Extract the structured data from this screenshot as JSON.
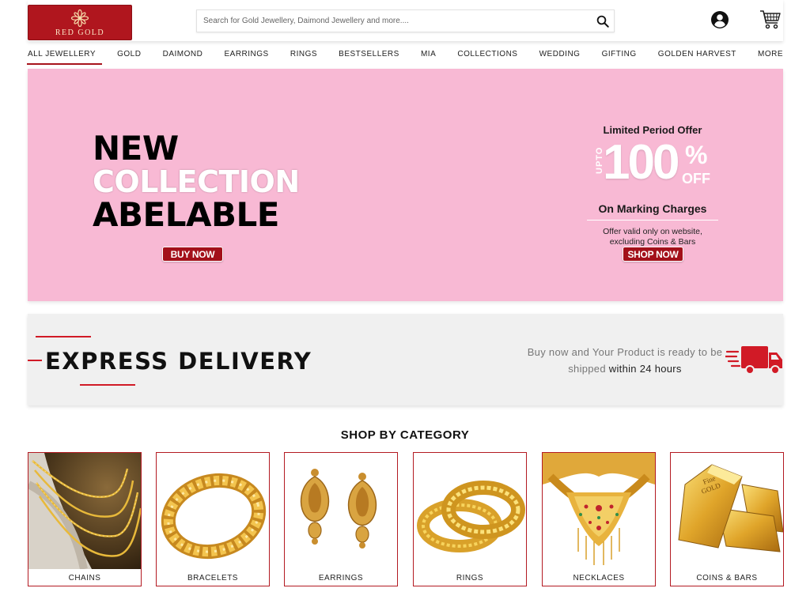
{
  "header": {
    "logo_text": "RED GOLD",
    "search_placeholder": "Search for Gold Jewellery, Daimond Jewellery and more....",
    "icons": [
      "search-icon",
      "user-icon",
      "cart-icon"
    ]
  },
  "nav": {
    "items": [
      {
        "label": "ALL JEWELLERY",
        "active": true
      },
      {
        "label": "GOLD"
      },
      {
        "label": "DAIMOND"
      },
      {
        "label": "EARRINGS"
      },
      {
        "label": "RINGS"
      },
      {
        "label": "BESTSELLERS"
      },
      {
        "label": "MIA"
      },
      {
        "label": "COLLECTIONS"
      },
      {
        "label": "WEDDING"
      },
      {
        "label": "GIFTING"
      },
      {
        "label": "GOLDEN HARVEST"
      },
      {
        "label": "MORE"
      }
    ]
  },
  "hero": {
    "line1": "NEW",
    "line2": "COLLECTION",
    "line3": "ABELABLE",
    "buy_label": "BUY NOW",
    "offer_title": "Limited Period Offer",
    "offer_upto": "UPTO",
    "offer_number": "100",
    "offer_percent": "%",
    "offer_off": "OFF",
    "offer_sub": "On Marking Charges",
    "offer_note": "Offer valid only on website, excluding Coins & Bars",
    "shop_label": "SHOP NOW"
  },
  "express": {
    "title": "EXPRESS DELIVERY",
    "text_part1": "Buy now and Your Product is ready to be shipped",
    "text_part2": "within 24 hours"
  },
  "categories": {
    "heading": "SHOP BY CATEGORY",
    "items": [
      {
        "label": "CHAINS"
      },
      {
        "label": "BRACELETS"
      },
      {
        "label": "EARRINGS"
      },
      {
        "label": "RINGS"
      },
      {
        "label": "NECKLACES"
      },
      {
        "label": "COINS & BARS"
      }
    ]
  },
  "colors": {
    "brand_red": "#b0161e",
    "banner_pink": "#f8b9d4",
    "express_bg": "#f0f0f0"
  }
}
